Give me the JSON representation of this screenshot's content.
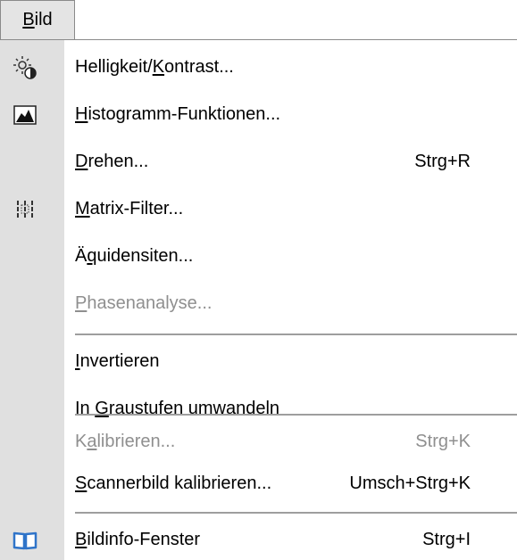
{
  "menubar": {
    "menu": {
      "text": "Bild",
      "mnemonic_index": 0
    }
  },
  "dropdown": {
    "items": [
      {
        "text": "Helligkeit/Kontrast...",
        "mnemonic_index": 11,
        "shortcut": "",
        "enabled": true,
        "icon": "brightness-contrast-icon"
      },
      {
        "text": "Histogramm-Funktionen...",
        "mnemonic_index": 0,
        "shortcut": "",
        "enabled": true,
        "icon": "histogram-icon"
      },
      {
        "text": "Drehen...",
        "mnemonic_index": 0,
        "shortcut": "Strg+R",
        "enabled": true,
        "icon": ""
      },
      {
        "text": "Matrix-Filter...",
        "mnemonic_index": 0,
        "shortcut": "",
        "enabled": true,
        "icon": "matrix-filter-icon"
      },
      {
        "text": "Äquidensiten...",
        "mnemonic_index": 1,
        "shortcut": "",
        "enabled": true,
        "icon": ""
      },
      {
        "text": "Phasenanalyse...",
        "mnemonic_index": 0,
        "shortcut": "",
        "enabled": false,
        "icon": ""
      },
      {
        "separator": true
      },
      {
        "text": "Invertieren",
        "mnemonic_index": 0,
        "shortcut": "",
        "enabled": true,
        "icon": ""
      },
      {
        "text": "In Graustufen umwandeln",
        "mnemonic_index": 3,
        "shortcut": "",
        "enabled": true,
        "icon": ""
      },
      {
        "separator": true
      },
      {
        "text": "Kalibrieren...",
        "mnemonic_index": 1,
        "shortcut": "Strg+K",
        "enabled": false,
        "icon": ""
      },
      {
        "text": "Scannerbild kalibrieren...",
        "mnemonic_index": 0,
        "shortcut": "Umsch+Strg+K",
        "enabled": true,
        "icon": ""
      },
      {
        "separator": true
      },
      {
        "text": "Bildinfo-Fenster",
        "mnemonic_index": 0,
        "shortcut": "Strg+I",
        "enabled": true,
        "icon": "book-icon"
      }
    ]
  },
  "colors": {
    "icon_column": "#e0e0e0",
    "disabled_text": "#8f8f8f",
    "separator": "#9e9e9e",
    "book_icon": "#2f74c9"
  }
}
